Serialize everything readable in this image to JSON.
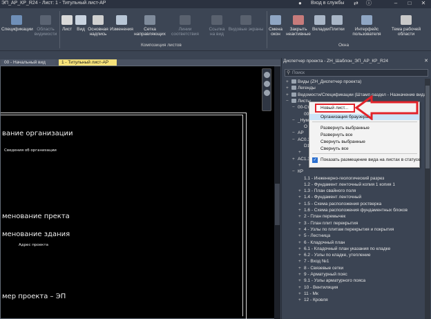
{
  "titlebar": {
    "title": "ЭП_АР_КР_R24 - Лист: 1 - Титульный лист-АР",
    "login": "Вход в службы",
    "icons": [
      "arrow-icon",
      "help-icon",
      "minimize-icon",
      "maximize-icon",
      "close-icon"
    ]
  },
  "ribbon": {
    "buttons": [
      {
        "label": "Спецификации",
        "icon": "schedule-icon",
        "dim": false
      },
      {
        "label": "Область видимости",
        "icon": "scope-box-icon",
        "dim": true
      },
      {
        "label": "Лист",
        "icon": "sheet-icon",
        "dim": false
      },
      {
        "label": "Вид",
        "icon": "view-icon",
        "dim": false
      },
      {
        "label": "Основная надпись",
        "icon": "title-block-icon",
        "dim": false
      },
      {
        "label": "Изменения",
        "icon": "revisions-icon",
        "dim": false
      },
      {
        "label": "Сетка направляющих",
        "icon": "guide-grid-icon",
        "dim": false
      },
      {
        "label": "Линии соответствия",
        "icon": "matchline-icon",
        "dim": true
      },
      {
        "label": "Ссылка на вид",
        "icon": "view-reference-icon",
        "dim": true
      },
      {
        "label": "Видовые экраны",
        "icon": "viewports-icon",
        "dim": true
      },
      {
        "label": "Смена окон",
        "icon": "switch-windows-icon",
        "dim": false
      },
      {
        "label": "Закрыть неактивные",
        "icon": "close-inactive-icon",
        "dim": false
      },
      {
        "label": "Вкладки",
        "icon": "tabs-icon",
        "dim": false
      },
      {
        "label": "Плитки",
        "icon": "tiles-icon",
        "dim": false
      },
      {
        "label": "Интерфейс пользователя",
        "icon": "user-interface-icon",
        "dim": false
      },
      {
        "label": "Тема рабочей области",
        "icon": "theme-icon",
        "dim": false
      }
    ],
    "group_sheet": "Композиция листов",
    "group_windows": "Окна"
  },
  "tabs": {
    "start": "00 - Начальный вид",
    "active": "1 - Титульный лист-АР"
  },
  "canvas": {
    "line1": "вание организации",
    "line2": "Сведения об организации",
    "line3": "менование пректа",
    "line4": "менование здания",
    "line5": "Адрес проекта",
    "line6": "мер проекта – ЭП"
  },
  "browser": {
    "title": "Диспетчер проекта - ZH_Шаблон_ЭП_АР_КР_R24",
    "search_placeholder": "Поиск",
    "items": [
      {
        "label": "Виды (ZH_Диспетчер проекта)",
        "ex": "+",
        "folder": true,
        "indent": 0
      },
      {
        "label": "Легенды",
        "ex": "+",
        "folder": true,
        "indent": 0
      },
      {
        "label": "Ведомости/Спецификации (Штамп раздел - Назначение вида)",
        "ex": "+",
        "folder": true,
        "indent": 0
      },
      {
        "label": "Листы",
        "ex": "−",
        "folder": true,
        "indent": 0
      },
      {
        "label": "00-Ст",
        "ex": "−",
        "folder": false,
        "indent": 1
      },
      {
        "label": "00",
        "ex": "",
        "folder": false,
        "indent": 2
      },
      {
        "label": "_Нум",
        "ex": "−",
        "folder": false,
        "indent": 1
      },
      {
        "label": "О",
        "ex": "",
        "folder": false,
        "indent": 2
      },
      {
        "label": "АР",
        "ex": "−",
        "folder": false,
        "indent": 1
      },
      {
        "label": "АС0.1",
        "ex": "−",
        "folder": false,
        "indent": 1
      },
      {
        "label": "D1",
        "ex": "",
        "folder": false,
        "indent": 2
      },
      {
        "label": "",
        "ex": "+",
        "folder": false,
        "indent": 2
      },
      {
        "label": "АС1.1",
        "ex": "+",
        "folder": false,
        "indent": 1
      },
      {
        "label": "",
        "ex": "+",
        "folder": false,
        "indent": 2
      },
      {
        "label": "КР",
        "ex": "−",
        "folder": false,
        "indent": 1
      },
      {
        "label": "1.1 - Инженерно-геологический разрез",
        "ex": "",
        "folder": false,
        "indent": 2
      },
      {
        "label": "1.2 - Фундамент ленточный копия 1 копия 1",
        "ex": "",
        "folder": false,
        "indent": 2
      },
      {
        "label": "1.3 - План свайного поля",
        "ex": "+",
        "folder": false,
        "indent": 2
      },
      {
        "label": "1.4 - Фундамент ленточный",
        "ex": "+",
        "folder": false,
        "indent": 2
      },
      {
        "label": "1.5 - Схема расположения ростверка",
        "ex": "+",
        "folder": false,
        "indent": 2
      },
      {
        "label": "1.6 - Схема расположения фундаментных блоков",
        "ex": "+",
        "folder": false,
        "indent": 2
      },
      {
        "label": "2 - План перемычек",
        "ex": "+",
        "folder": false,
        "indent": 2
      },
      {
        "label": "3 - План плит перекрытия",
        "ex": "+",
        "folder": false,
        "indent": 2
      },
      {
        "label": "4 - Узлы по плитам перекрытия и покрытия",
        "ex": "+",
        "folder": false,
        "indent": 2
      },
      {
        "label": "5 - Лестница",
        "ex": "+",
        "folder": false,
        "indent": 2
      },
      {
        "label": "6 - Кладочный план",
        "ex": "+",
        "folder": false,
        "indent": 2
      },
      {
        "label": "6.1 - Кладочный план указания по кладке",
        "ex": "+",
        "folder": false,
        "indent": 2
      },
      {
        "label": "6.2 - Узлы по кладке, утепление",
        "ex": "+",
        "folder": false,
        "indent": 2
      },
      {
        "label": "7 - Вход №1",
        "ex": "+",
        "folder": false,
        "indent": 2
      },
      {
        "label": "8 - Связевые сетки",
        "ex": "+",
        "folder": false,
        "indent": 2
      },
      {
        "label": "9 - Арматурный пояс",
        "ex": "+",
        "folder": false,
        "indent": 2
      },
      {
        "label": "9.1 - Узлы арматурного пояса",
        "ex": "+",
        "folder": false,
        "indent": 2
      },
      {
        "label": "10 - Вентиляция",
        "ex": "+",
        "folder": false,
        "indent": 2
      },
      {
        "label": "11 - Мк",
        "ex": "+",
        "folder": false,
        "indent": 2
      },
      {
        "label": "12 - Кровля",
        "ex": "+",
        "folder": false,
        "indent": 2
      }
    ]
  },
  "context_menu": {
    "items": [
      {
        "label": "Новый лист...",
        "style": "new"
      },
      {
        "label": "Организация браузера...",
        "style": "hl"
      },
      {
        "label": "",
        "style": "sep"
      },
      {
        "label": "Развернуть выбранные",
        "style": ""
      },
      {
        "label": "Развернуть все",
        "style": ""
      },
      {
        "label": "Свернуть выбранные",
        "style": ""
      },
      {
        "label": "Свернуть все",
        "style": ""
      },
      {
        "label": "",
        "style": "sep"
      },
      {
        "label": "Показать размещение вида на листах в статусе",
        "style": "check"
      }
    ],
    "accent": "#e2232a"
  }
}
